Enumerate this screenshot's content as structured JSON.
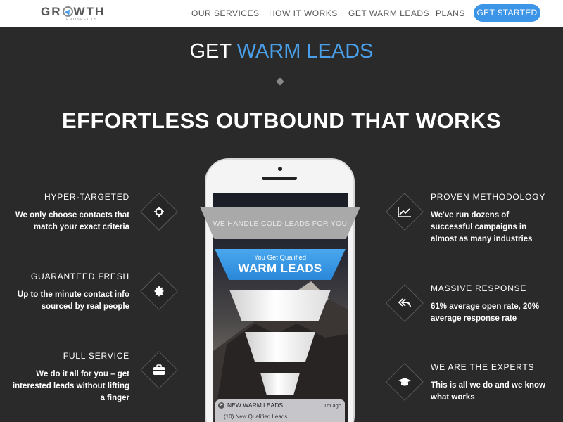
{
  "header": {
    "logo_main_pre": "GR",
    "logo_main_post": "WTH",
    "logo_sub": "PROSPECTS",
    "nav": [
      "OUR SERVICES",
      "HOW IT WORKS",
      "GET WARM LEADS",
      "PLANS"
    ],
    "cta": "GET STARTED"
  },
  "section": {
    "title_plain": "GET ",
    "title_accent": "WARM LEADS",
    "headline": "EFFORTLESS OUTBOUND THAT WORKS"
  },
  "features_left": [
    {
      "title": "HYPER-TARGETED",
      "desc": "We only choose contacts that match your exact criteria",
      "icon": "crosshair-icon"
    },
    {
      "title": "GUARANTEED FRESH",
      "desc": "Up to the minute contact info sourced by real people",
      "icon": "badge-icon"
    },
    {
      "title": "FULL SERVICE",
      "desc": "We do it all for you – get interested leads without lifting a finger",
      "icon": "briefcase-icon"
    }
  ],
  "features_right": [
    {
      "title": "PROVEN METHODOLOGY",
      "desc": "We've run dozens of successful campaigns in almost as many industries",
      "icon": "line-chart-icon"
    },
    {
      "title": "MASSIVE RESPONSE",
      "desc": "61% average open rate, 20% average response rate",
      "icon": "reply-all-icon"
    },
    {
      "title": "WE ARE THE EXPERTS",
      "desc": "This is all we do and we know what works",
      "icon": "graduation-cap-icon"
    }
  ],
  "phone": {
    "funnel_top": "WE HANDLE COLD LEADS FOR YOU",
    "funnel_blue_small": "You Get Qualified",
    "funnel_blue_big": "WARM LEADS",
    "notif_title": "NEW WARM LEADS",
    "notif_time": "1m ago",
    "notif_body": "(10) New Qualified Leads"
  },
  "colors": {
    "accent": "#4a9fe8",
    "background": "#2a2a2a",
    "cta": "#3d95e8"
  }
}
